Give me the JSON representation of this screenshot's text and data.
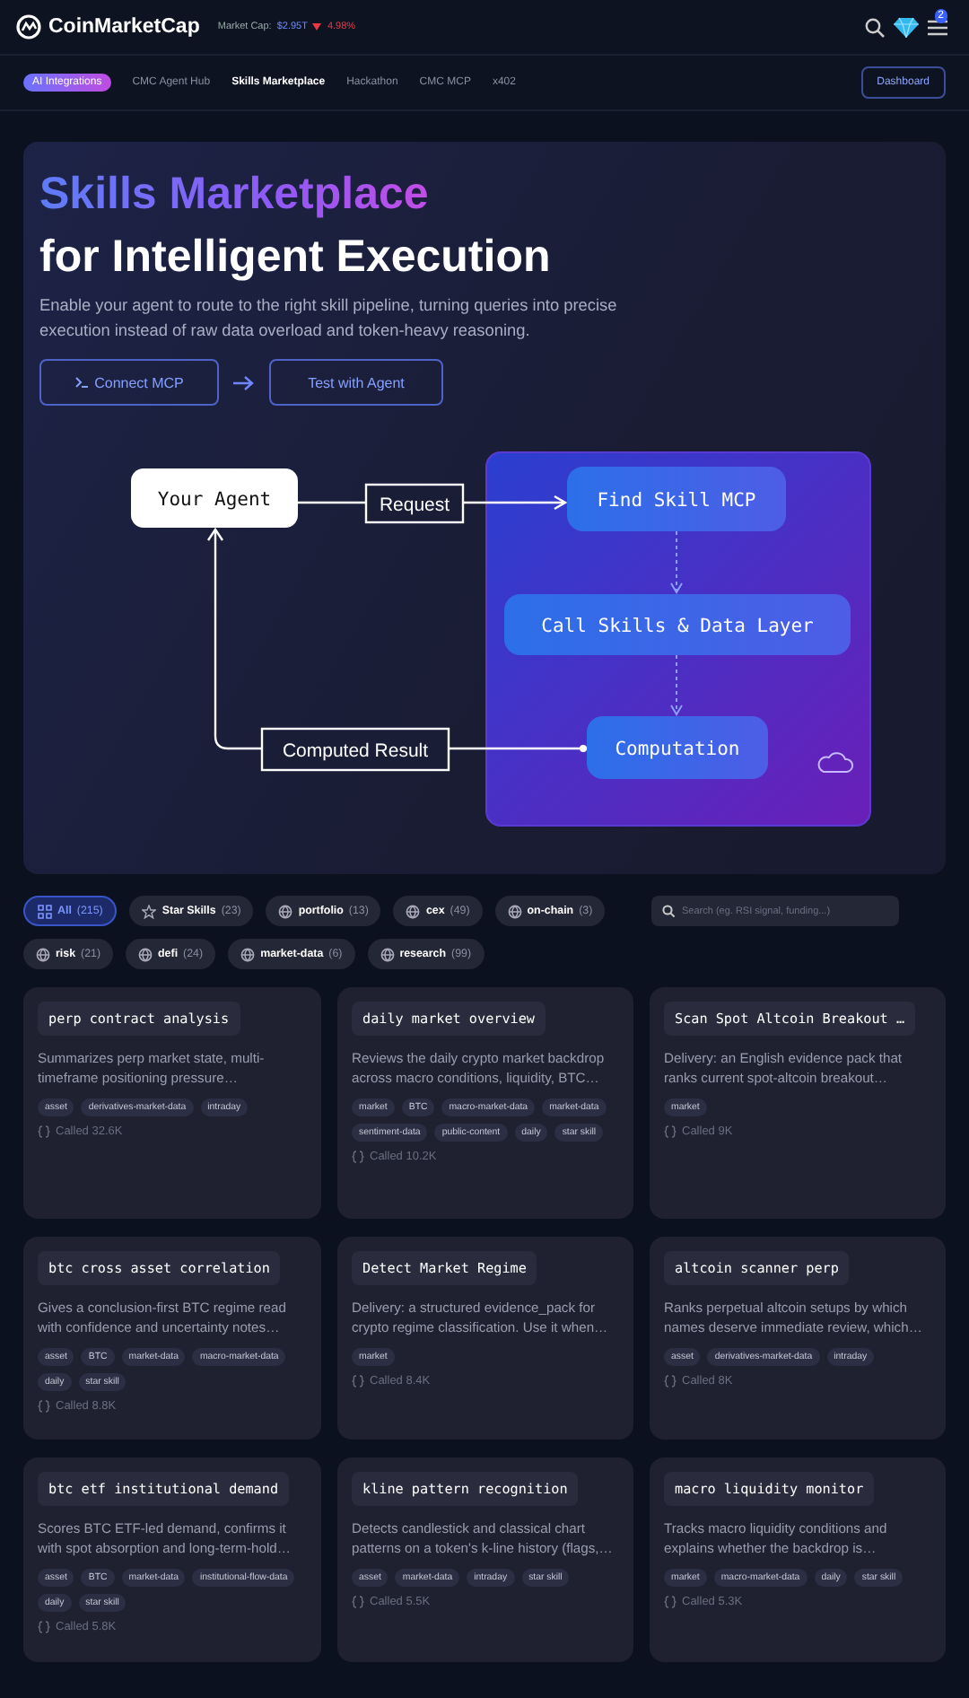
{
  "header": {
    "brand": "CoinMarketCap",
    "market_cap_label": "Market Cap:",
    "market_cap_value": "$2.95T",
    "market_cap_change": "4.98%",
    "menu_badge": "2"
  },
  "nav": {
    "badge": "AI Integrations",
    "links": [
      {
        "label": "CMC Agent Hub",
        "selected": false
      },
      {
        "label": "Skills Marketplace",
        "selected": true
      },
      {
        "label": "Hackathon",
        "selected": false
      },
      {
        "label": "CMC MCP",
        "selected": false
      },
      {
        "label": "x402",
        "selected": false
      }
    ],
    "button": "Dashboard"
  },
  "hero": {
    "title": "Skills Marketplace",
    "subtitle": "for Intelligent Execution",
    "description": "Enable your agent to route to the right skill pipeline, turning queries into precise execution instead of raw data overload and token-heavy reasoning.",
    "buttons": [
      "Connect MCP",
      "Test with Agent"
    ]
  },
  "diagram": {
    "agent": "Your Agent",
    "request": "Request",
    "nodes": [
      "Find Skill MCP",
      "Call Skills & Data Layer",
      "Computation"
    ],
    "result": "Computed Result"
  },
  "filters": [
    {
      "kind": "all",
      "label": "All",
      "count": "(215)",
      "selected": true
    },
    {
      "kind": "star",
      "label": "Star Skills",
      "count": "(23)",
      "selected": false
    },
    {
      "kind": "category",
      "label": "portfolio",
      "count": "(13)",
      "selected": false
    },
    {
      "kind": "category",
      "label": "cex",
      "count": "(49)",
      "selected": false
    },
    {
      "kind": "category",
      "label": "on-chain",
      "count": "(3)",
      "selected": false
    },
    {
      "kind": "search",
      "placeholder": "Search (eg. RSI signal, funding...)"
    },
    {
      "kind": "category",
      "label": "risk",
      "count": "(21)",
      "selected": false
    },
    {
      "kind": "category",
      "label": "defi",
      "count": "(24)",
      "selected": false
    },
    {
      "kind": "category",
      "label": "market-data",
      "count": "(6)",
      "selected": false
    },
    {
      "kind": "category",
      "label": "research",
      "count": "(99)",
      "selected": false
    }
  ],
  "cards": [
    {
      "title": "perp contract analysis",
      "description": "Summarizes perp market state, multi-timeframe positioning pressure…",
      "tags": [
        "asset",
        "derivatives-market-data",
        "intraday"
      ],
      "calls": "Called 32.6K"
    },
    {
      "title": "daily market overview",
      "description": "Reviews the daily crypto market backdrop across macro conditions, liquidity, BTC…",
      "tags": [
        "market",
        "BTC",
        "macro-market-data",
        "market-data",
        "sentiment-data",
        "public-content",
        "daily",
        "star skill"
      ],
      "calls": "Called 10.2K"
    },
    {
      "title": "Scan Spot Altcoin Breakout …",
      "description": "Delivery: an English evidence pack that ranks current spot-altcoin breakout…",
      "tags": [
        "market"
      ],
      "calls": "Called 9K"
    },
    {
      "title": "btc cross asset correlation",
      "description": "Gives a conclusion-first BTC regime read with confidence and uncertainty notes…",
      "tags": [
        "asset",
        "BTC",
        "market-data",
        "macro-market-data",
        "daily",
        "star skill"
      ],
      "calls": "Called 8.8K"
    },
    {
      "title": "Detect Market Regime",
      "description": "Delivery: a structured evidence_pack for crypto regime classification. Use it when…",
      "tags": [
        "market"
      ],
      "calls": "Called 8.4K"
    },
    {
      "title": "altcoin scanner perp",
      "description": "Ranks perpetual altcoin setups by which names deserve immediate review, which…",
      "tags": [
        "asset",
        "derivatives-market-data",
        "intraday"
      ],
      "calls": "Called 8K"
    },
    {
      "title": "btc etf institutional demand",
      "description": "Scores BTC ETF-led demand, confirms it with spot absorption and long-term-hold…",
      "tags": [
        "asset",
        "BTC",
        "market-data",
        "institutional-flow-data",
        "daily",
        "star skill"
      ],
      "calls": "Called 5.8K"
    },
    {
      "title": "kline pattern recognition",
      "description": "Detects candlestick and classical chart patterns on a token's k-line history (flags,…",
      "tags": [
        "asset",
        "market-data",
        "intraday",
        "star skill"
      ],
      "calls": "Called 5.5K"
    },
    {
      "title": "macro liquidity monitor",
      "description": "Tracks macro liquidity conditions and explains whether the backdrop is…",
      "tags": [
        "market",
        "macro-market-data",
        "daily",
        "star skill"
      ],
      "calls": "Called 5.3K"
    }
  ]
}
